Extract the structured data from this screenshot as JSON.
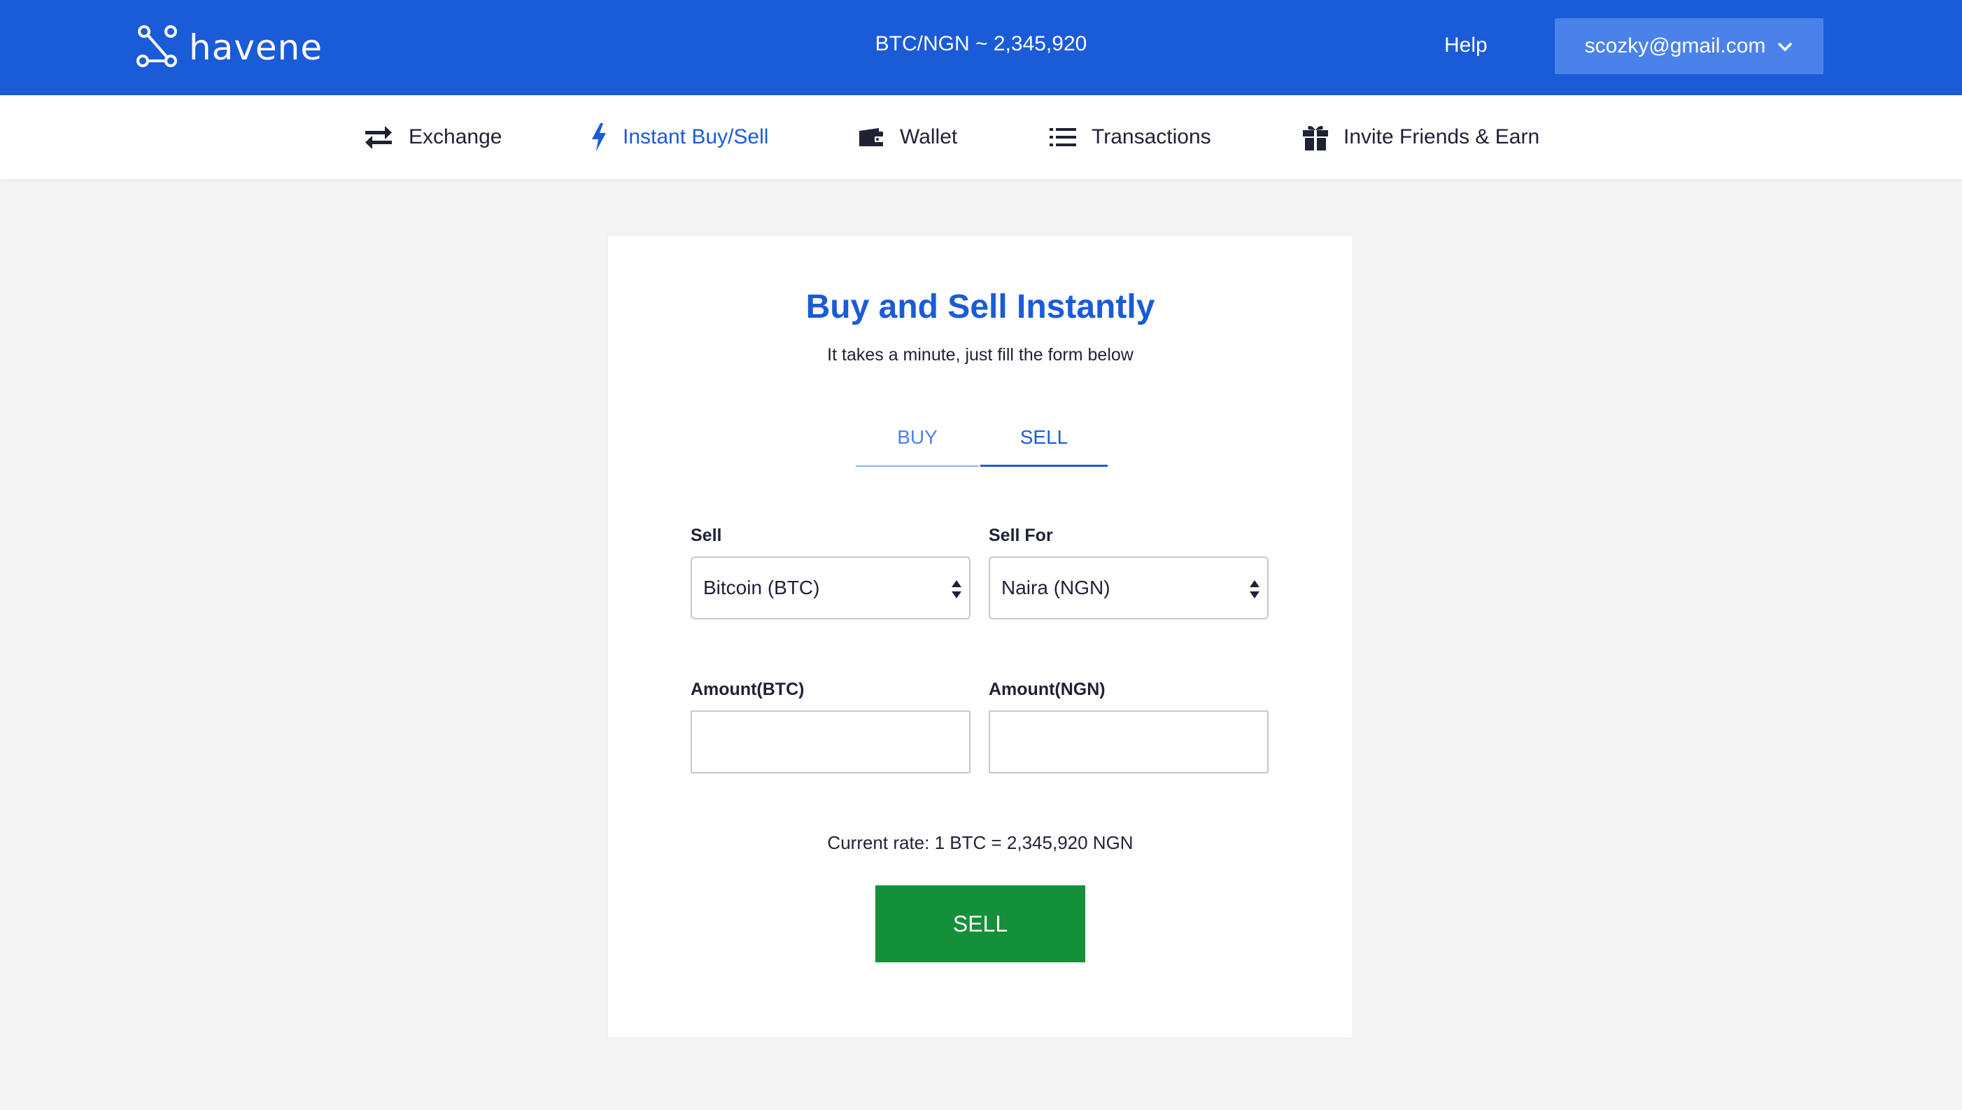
{
  "header": {
    "brand": "havene",
    "ticker": "BTC/NGN ~ 2,345,920",
    "help_label": "Help",
    "account_email": "scozky@gmail.com",
    "bg_color": "#1a5bd8"
  },
  "nav": {
    "items": [
      {
        "label": "Exchange",
        "icon": "exchange-arrows-icon"
      },
      {
        "label": "Instant Buy/Sell",
        "icon": "lightning-icon",
        "active": true
      },
      {
        "label": "Wallet",
        "icon": "wallet-icon"
      },
      {
        "label": "Transactions",
        "icon": "list-icon"
      },
      {
        "label": "Invite Friends & Earn",
        "icon": "gift-icon"
      }
    ]
  },
  "form": {
    "title": "Buy and Sell Instantly",
    "subtitle": "It takes a minute, just fill the form below",
    "tabs": {
      "buy": "BUY",
      "sell": "SELL",
      "active": "SELL"
    },
    "sell_label": "Sell",
    "sell_value": "Bitcoin (BTC)",
    "sell_for_label": "Sell For",
    "sell_for_value": "Naira (NGN)",
    "amount_btc_label": "Amount(BTC)",
    "amount_btc_value": "",
    "amount_ngn_label": "Amount(NGN)",
    "amount_ngn_value": "",
    "rate_text": "Current rate: 1 BTC = 2,345,920 NGN",
    "submit_label": "SELL",
    "submit_color": "#15903a"
  }
}
